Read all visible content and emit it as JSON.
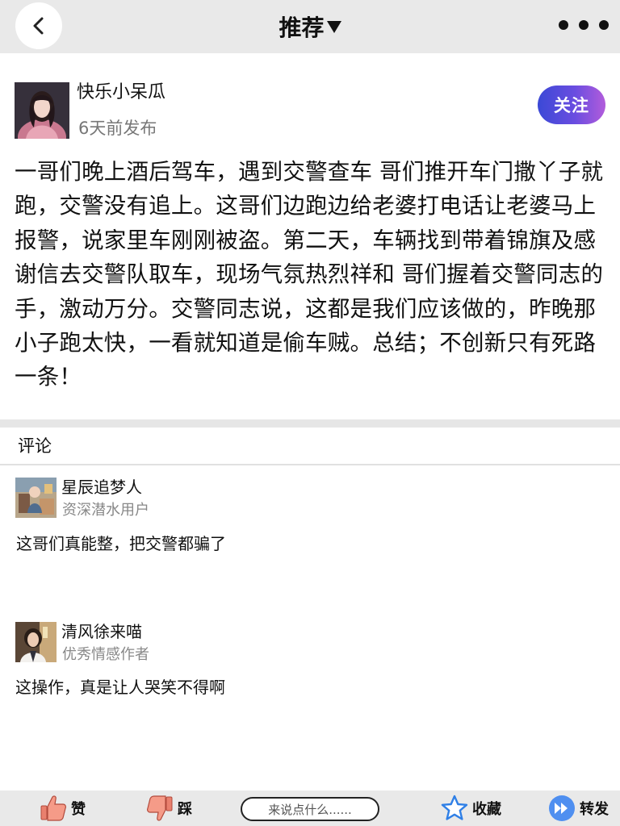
{
  "header": {
    "title": "推荐",
    "back_icon": "chevron-left-icon",
    "more_icon": "more-dots-icon"
  },
  "author": {
    "name": "快乐小呆瓜",
    "time": "6天前发布",
    "follow_label": "关注"
  },
  "post": {
    "text": "一哥们晚上酒后驾车，遇到交警查车 哥们推开车门撒丫子就跑，交警没有追上。这哥们边跑边给老婆打电话让老婆马上报警，说家里车刚刚被盗。第二天，车辆找到带着锦旗及感谢信去交警队取车，现场气氛热烈祥和 哥们握着交警同志的手，激动万分。交警同志说，这都是我们应该做的，昨晚那小子跑太快，一看就知道是偷车贼。总结；不创新只有死路一条！"
  },
  "comments": {
    "title": "评论",
    "items": [
      {
        "name": "星辰追梦人",
        "role": "资深潜水用户",
        "text": "这哥们真能整，把交警都骗了"
      },
      {
        "name": "清风徐来喵",
        "role": "优秀情感作者",
        "text": "这操作，真是让人哭笑不得啊"
      }
    ]
  },
  "bottom_bar": {
    "like_label": "赞",
    "dislike_label": "踩",
    "input_placeholder": "来说点什么......",
    "favorite_label": "收藏",
    "share_label": "转发"
  },
  "colors": {
    "header_bg": "#e9e9e9",
    "follow_gradient_start": "#3b49d6",
    "follow_gradient_end": "#b25cdb",
    "muted_text": "#777777"
  }
}
